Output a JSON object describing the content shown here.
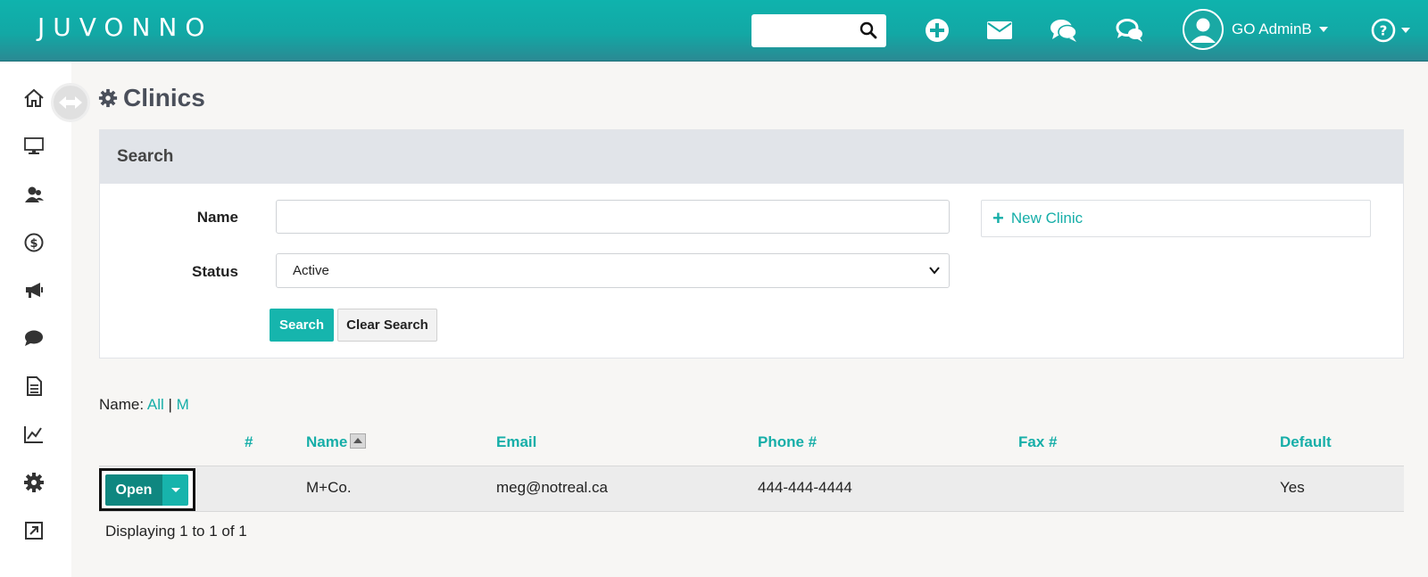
{
  "header": {
    "logo": "JUVONNO",
    "search_placeholder": "",
    "user_name": "GO AdminB"
  },
  "page": {
    "title": "Clinics"
  },
  "search_panel": {
    "title": "Search",
    "name_label": "Name",
    "name_value": "",
    "status_label": "Status",
    "status_value": "Active",
    "search_button": "Search",
    "clear_button": "Clear Search",
    "new_clinic_label": "New Clinic"
  },
  "filter": {
    "prefix": "Name: ",
    "all": "All",
    "sep": " | ",
    "m": "M"
  },
  "table": {
    "headers": {
      "num": "#",
      "name": "Name",
      "email": "Email",
      "phone": "Phone #",
      "fax": "Fax #",
      "default": "Default"
    },
    "rows": [
      {
        "open_label": "Open",
        "num": "",
        "name": "M+Co.",
        "email": "meg@notreal.ca",
        "phone": "444-444-4444",
        "fax": "",
        "default": "Yes"
      }
    ],
    "footer": "Displaying 1 to 1 of 1"
  },
  "colors": {
    "accent": "#16aea8",
    "header_top": "#0fb3ad",
    "header_bottom": "#2a8a93",
    "open_button": "#0f8780"
  },
  "icons": {
    "sidebar": [
      "home-icon",
      "monitor-icon",
      "users-icon",
      "dollar-icon",
      "megaphone-icon",
      "chat-icon",
      "document-icon",
      "chart-icon",
      "gear-icon",
      "external-link-icon"
    ],
    "top": [
      "search-icon",
      "plus-circle-icon",
      "mail-icon",
      "chat-bubbles-icon",
      "support-chat-icon",
      "user-avatar-icon",
      "help-icon"
    ]
  }
}
